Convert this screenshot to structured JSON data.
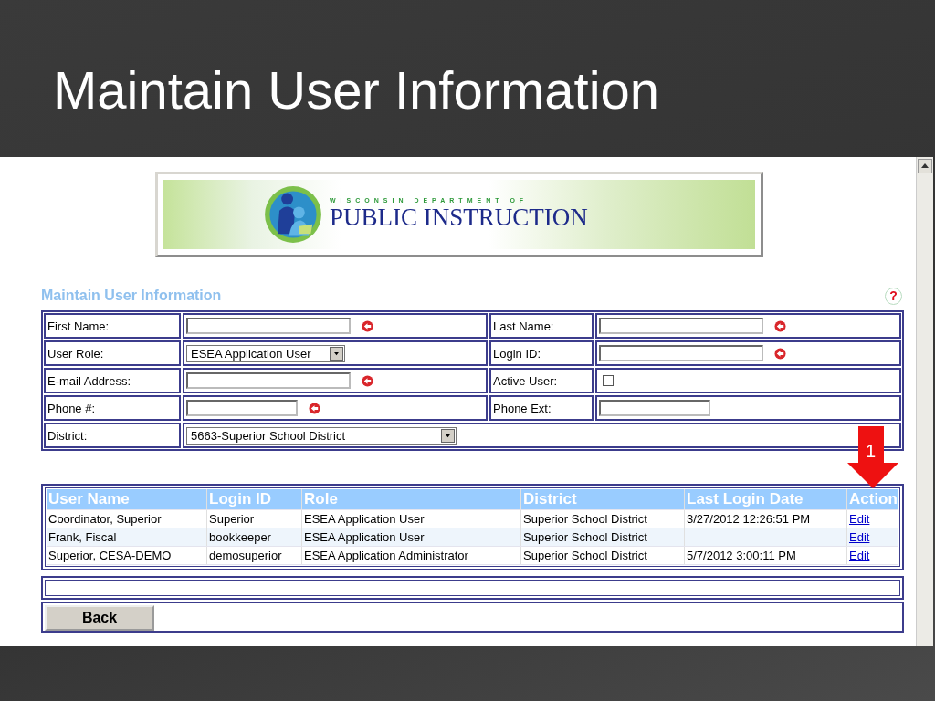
{
  "slide": {
    "title": "Maintain User Information"
  },
  "banner": {
    "line_1": "WISCONSIN DEPARTMENT OF",
    "line_2": "PUBLIC INSTRUCTION"
  },
  "form": {
    "heading": "Maintain User Information",
    "rows": [
      [
        {
          "label": "First Name:",
          "kind": "text",
          "required": true
        },
        {
          "label": "Last Name:",
          "kind": "text",
          "required": true
        }
      ],
      [
        {
          "label": "User Role:",
          "kind": "select",
          "value": "ESEA Application User"
        },
        {
          "label": "Login ID:",
          "kind": "text",
          "required": true
        }
      ],
      [
        {
          "label": "E-mail Address:",
          "kind": "text",
          "required": true
        },
        {
          "label": "Active User:",
          "kind": "checkbox",
          "checked": false
        }
      ],
      [
        {
          "label": "Phone #:",
          "kind": "short_text",
          "required": true
        },
        {
          "label": "Phone Ext:",
          "kind": "short_text",
          "required": false
        }
      ],
      [
        {
          "label": "District:",
          "kind": "wide_select",
          "value": "5663-Superior School District"
        }
      ]
    ]
  },
  "table": {
    "columns": [
      "User Name",
      "Login ID",
      "Role",
      "District",
      "Last Login Date",
      "Action"
    ],
    "rows": [
      {
        "user_name": "Coordinator, Superior",
        "login_id": "Superior",
        "role": "ESEA Application User",
        "district": "Superior School District",
        "last_login": "3/27/2012 12:26:51 PM",
        "action": "Edit"
      },
      {
        "user_name": "Frank, Fiscal",
        "login_id": "bookkeeper",
        "role": "ESEA Application User",
        "district": "Superior School District",
        "action": "Edit"
      },
      {
        "user_name": "Superior, CESA-DEMO",
        "login_id": "demosuperior",
        "role": "ESEA Application Administrator",
        "district": "Superior School District",
        "last_login": "5/7/2012 3:00:11 PM",
        "action": "Edit"
      }
    ]
  },
  "back_button": "Back",
  "callout": {
    "number": "1"
  },
  "help_icon": "?"
}
